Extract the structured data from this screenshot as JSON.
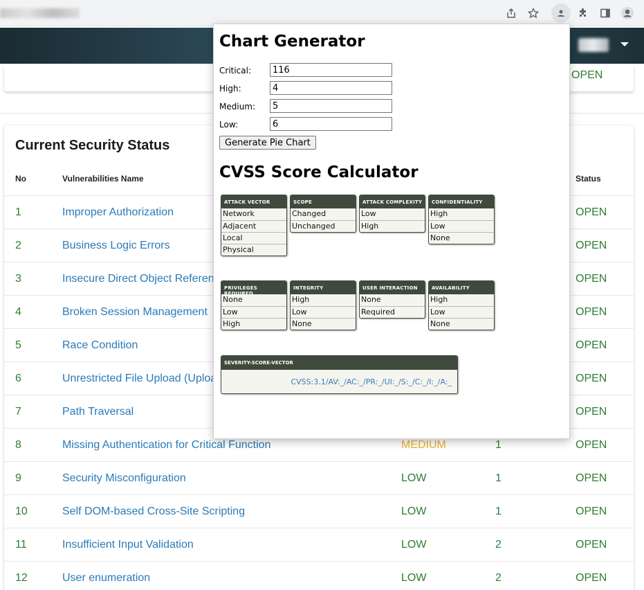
{
  "popup": {
    "chart_title": "Chart Generator",
    "fields": [
      {
        "label": "Critical:",
        "value": "116"
      },
      {
        "label": "High:",
        "value": "4"
      },
      {
        "label": "Medium:",
        "value": "5"
      },
      {
        "label": "Low:",
        "value": "6"
      }
    ],
    "generate_label": "Generate Pie Chart",
    "cvss_title": "CVSS Score Calculator",
    "metrics": [
      {
        "title": "ATTACK VECTOR",
        "options": [
          "Network",
          "Adjacent",
          "Local",
          "Physical"
        ]
      },
      {
        "title": "SCOPE",
        "options": [
          "Changed",
          "Unchanged"
        ]
      },
      {
        "title": "ATTACK COMPLEXITY",
        "options": [
          "Low",
          "High"
        ]
      },
      {
        "title": "CONFIDENTIALITY",
        "options": [
          "High",
          "Low",
          "None"
        ]
      },
      {
        "title": "PRIVILEGES REQUIRED",
        "options": [
          "None",
          "Low",
          "High"
        ]
      },
      {
        "title": "INTEGRITY",
        "options": [
          "High",
          "Low",
          "None"
        ]
      },
      {
        "title": "USER INTERACTION",
        "options": [
          "None",
          "Required"
        ]
      },
      {
        "title": "AVAILABILITY",
        "options": [
          "High",
          "Low",
          "None"
        ]
      }
    ],
    "vector_title": "SEVERITY-SCORE-VECTOR",
    "vector_value": "CVSS:3.1/AV:_/AC:_/PR:_/UI:_/S:_/C:_/I:_/A:_"
  },
  "top_card": {
    "status": "OPEN"
  },
  "security": {
    "title": "Current Security Status",
    "headers": {
      "no": "No",
      "name": "Vulnerabilities Name",
      "status": "Status"
    },
    "rows": [
      {
        "no": "1",
        "name": "Improper Authorization",
        "severity": "",
        "count": "",
        "status": "OPEN"
      },
      {
        "no": "2",
        "name": "Business Logic Errors",
        "severity": "",
        "count": "",
        "status": "OPEN"
      },
      {
        "no": "3",
        "name": "Insecure Direct Object Reference",
        "severity": "",
        "count": "",
        "status": "OPEN"
      },
      {
        "no": "4",
        "name": "Broken Session Management",
        "severity": "",
        "count": "",
        "status": "OPEN"
      },
      {
        "no": "5",
        "name": "Race Condition",
        "severity": "",
        "count": "",
        "status": "OPEN"
      },
      {
        "no": "6",
        "name": "Unrestricted File Upload (Upload",
        "severity": "",
        "count": "",
        "status": "OPEN"
      },
      {
        "no": "7",
        "name": "Path Traversal",
        "severity": "",
        "count": "",
        "status": "OPEN"
      },
      {
        "no": "8",
        "name": "Missing Authentication for Critical Function",
        "severity": "MEDIUM",
        "count": "1",
        "status": "OPEN"
      },
      {
        "no": "9",
        "name": "Security Misconfiguration",
        "severity": "LOW",
        "count": "1",
        "status": "OPEN"
      },
      {
        "no": "10",
        "name": "Self DOM-based Cross-Site Scripting",
        "severity": "LOW",
        "count": "1",
        "status": "OPEN"
      },
      {
        "no": "11",
        "name": "Insufficient Input Validation",
        "severity": "LOW",
        "count": "2",
        "status": "OPEN"
      },
      {
        "no": "12",
        "name": "User enumeration",
        "severity": "LOW",
        "count": "2",
        "status": "OPEN"
      }
    ]
  },
  "browser": {
    "icons": [
      "share-icon",
      "bookmark-star-icon",
      "extension-active-icon",
      "puzzle-icon",
      "side-panel-icon",
      "profile-icon"
    ]
  }
}
